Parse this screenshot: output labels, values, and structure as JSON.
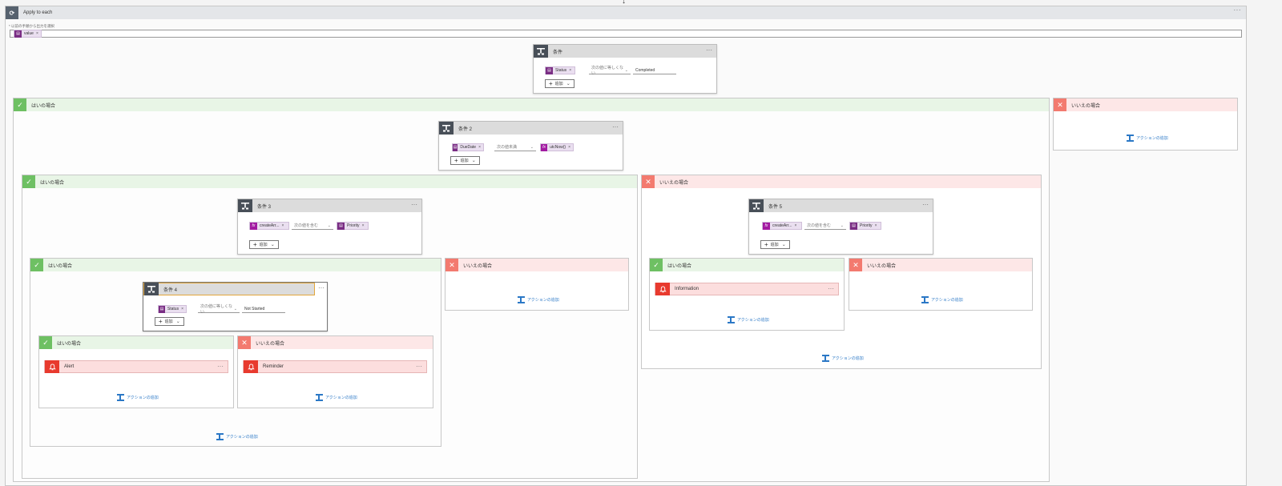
{
  "top_arrow": "↓",
  "loop": {
    "title": "Apply to each",
    "field_label": "* 以前の手順から出力を選択",
    "token": "value",
    "more": "···"
  },
  "remove_x": "×",
  "more": "···",
  "add_label": "追加",
  "add_action": "アクションの追加",
  "yes_label": "はいの場合",
  "no_label": "いいえの場合",
  "condition1": {
    "title": "条件",
    "left": "Status",
    "op": "次の値に等しくない",
    "value": "Completed"
  },
  "condition2": {
    "title": "条件 2",
    "left": "DueDate",
    "op": "次の値未満",
    "value": "utcNow()"
  },
  "condition3": {
    "title": "条件 3",
    "left": "createArr...",
    "op": "次の値を含む",
    "value": "Priority"
  },
  "condition4": {
    "title": "条件 4",
    "left": "Status",
    "op": "次の値に等しくない",
    "value": "Not Started"
  },
  "condition5": {
    "title": "条件 5",
    "left": "createArr...",
    "op": "次の値を含む",
    "value": "Priority"
  },
  "actions": {
    "alert": "Alert",
    "reminder": "Reminder",
    "information": "Information"
  },
  "colors": {
    "yes_header": "#e8f5e6",
    "no_header": "#fde7e7",
    "yes_icon": "#6ec063",
    "no_icon": "#f37a6f",
    "condition_icon": "#484f58",
    "token": "#7a2d84",
    "notify": "#e83a2e",
    "link": "#2b78c6"
  }
}
